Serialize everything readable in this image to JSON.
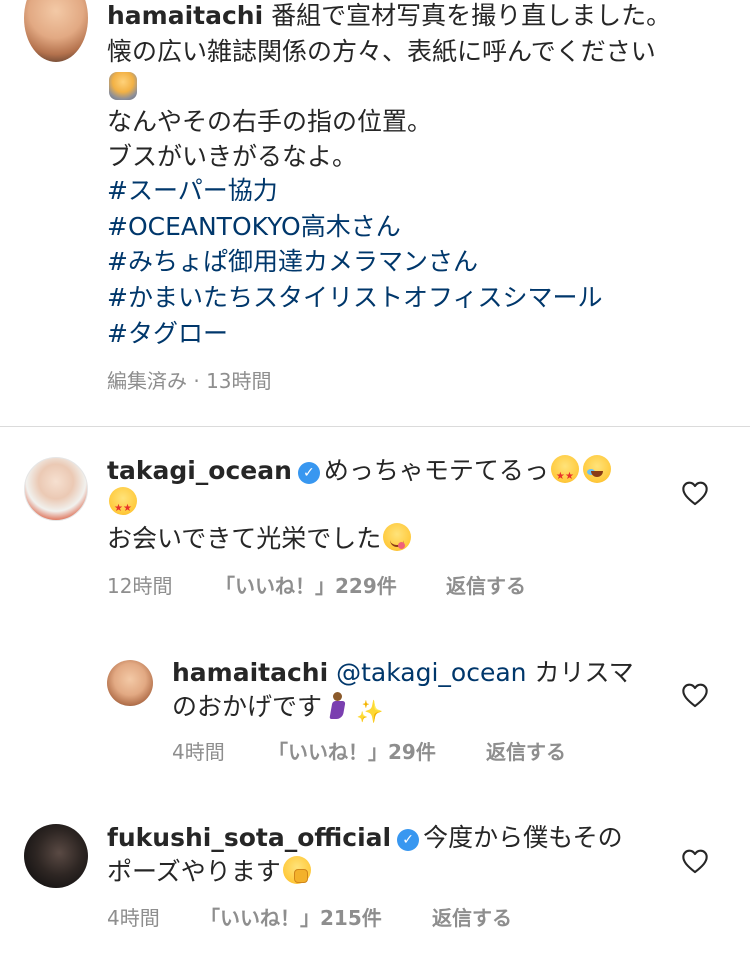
{
  "post": {
    "username": "hamaitachi",
    "caption_line1": "番組で宣材写真を撮り直しました。",
    "caption_line2": "懐の広い雑誌関係の方々、表紙に呼んでください",
    "caption_line3": "なんやその右手の指の位置。",
    "caption_line4": "ブスがいきがるなよ。",
    "hashtags": [
      "#スーパー協力",
      "#OCEANTOKYO高木さん",
      "#みちょぱ御用達カメラマンさん",
      "#かまいたちスタイリストオフィスシマール",
      "#タグロー"
    ],
    "meta": "編集済み · 13時間",
    "emoji_bow": "person-bowing-emoji"
  },
  "comments": [
    {
      "username": "takagi_ocean",
      "verified": true,
      "text_line1": "めっちゃモテてるっ",
      "text_line2": "お会いできて光栄でした",
      "time": "12時間",
      "likes": "「いいね！」229件",
      "reply": "返信する",
      "emojis": [
        "star-struck-emoji",
        "rolling-laughing-emoji",
        "star-struck-emoji",
        "savoring-food-emoji"
      ]
    },
    {
      "username": "hamaitachi",
      "verified": false,
      "mention": "@takagi_ocean",
      "text_line1": "カリスマ",
      "text_line2": "のおかげです",
      "time": "4時間",
      "likes": "「いいね！」29件",
      "reply": "返信する",
      "emojis": [
        "man-dancing-emoji",
        "sparkles-emoji"
      ]
    },
    {
      "username": "fukushi_sota_official",
      "verified": true,
      "text_line1": "今度から僕もその",
      "text_line2": "ポーズやります",
      "time": "4時間",
      "likes": "「いいね！」215件",
      "reply": "返信する",
      "emojis": [
        "shushing-face-emoji"
      ]
    }
  ],
  "colors": {
    "text": "#262626",
    "link": "#00376b",
    "meta": "#8e8e8e",
    "verified": "#3897f0",
    "divider": "#dbdbdb"
  },
  "icons": {
    "like": "heart-outline-icon",
    "verified": "verified-badge-icon"
  }
}
